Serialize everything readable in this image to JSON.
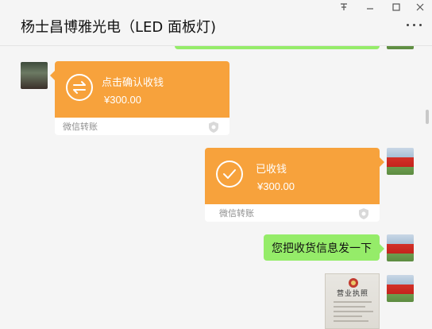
{
  "window": {
    "pin_icon": "pin-icon",
    "minimize_icon": "minimize-icon",
    "maximize_icon": "maximize-icon",
    "close_icon": "close-icon"
  },
  "header": {
    "title": "杨士昌博雅光电（LED 面板灯)",
    "more_icon": "more-icon"
  },
  "messages": {
    "incoming_transfer": {
      "label": "点击确认收钱",
      "amount": "¥300.00",
      "footer": "微信转账",
      "icon": "transfer-arrows-icon"
    },
    "outgoing_transfer": {
      "label": "已收钱",
      "amount": "¥300.00",
      "footer": "微信转账",
      "icon": "checkmark-icon"
    },
    "text_message": "您把收货信息发一下",
    "image_message": {
      "title": "营业执照"
    }
  },
  "colors": {
    "transfer_orange": "#f7a23c",
    "bubble_green": "#95ec69",
    "background": "#f5f5f5"
  }
}
